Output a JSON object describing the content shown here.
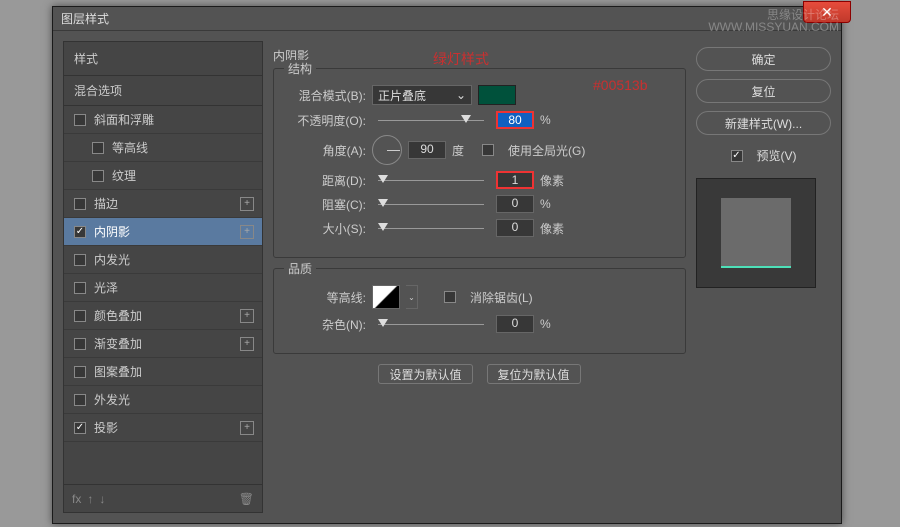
{
  "window": {
    "title": "图层样式"
  },
  "watermark": {
    "line1": "思缘设计论坛",
    "line2": "WWW.MISSYUAN.COM"
  },
  "annotations": {
    "greenStyle": "绿灯样式",
    "colorHex": "#00513b"
  },
  "leftPanel": {
    "stylesHeader": "样式",
    "blendHeader": "混合选项",
    "items": [
      {
        "label": "斜面和浮雕",
        "checked": false,
        "hasAdd": false,
        "sub": false
      },
      {
        "label": "等高线",
        "checked": false,
        "hasAdd": false,
        "sub": true
      },
      {
        "label": "纹理",
        "checked": false,
        "hasAdd": false,
        "sub": true
      },
      {
        "label": "描边",
        "checked": false,
        "hasAdd": true,
        "sub": false
      },
      {
        "label": "内阴影",
        "checked": true,
        "hasAdd": true,
        "sub": false,
        "selected": true
      },
      {
        "label": "内发光",
        "checked": false,
        "hasAdd": false,
        "sub": false
      },
      {
        "label": "光泽",
        "checked": false,
        "hasAdd": false,
        "sub": false
      },
      {
        "label": "颜色叠加",
        "checked": false,
        "hasAdd": true,
        "sub": false
      },
      {
        "label": "渐变叠加",
        "checked": false,
        "hasAdd": true,
        "sub": false
      },
      {
        "label": "图案叠加",
        "checked": false,
        "hasAdd": false,
        "sub": false
      },
      {
        "label": "外发光",
        "checked": false,
        "hasAdd": false,
        "sub": false
      },
      {
        "label": "投影",
        "checked": true,
        "hasAdd": true,
        "sub": false
      }
    ],
    "footer": {
      "fx": "fx"
    }
  },
  "center": {
    "title": "内阴影",
    "structure": {
      "groupLabel": "结构",
      "blendMode": {
        "label": "混合模式(B):",
        "value": "正片叠底"
      },
      "opacity": {
        "label": "不透明度(O):",
        "value": "80",
        "unit": "%"
      },
      "angle": {
        "label": "角度(A):",
        "value": "90",
        "unit": "度",
        "globalLight": "使用全局光(G)"
      },
      "distance": {
        "label": "距离(D):",
        "value": "1",
        "unit": "像素"
      },
      "choke": {
        "label": "阻塞(C):",
        "value": "0",
        "unit": "%"
      },
      "size": {
        "label": "大小(S):",
        "value": "0",
        "unit": "像素"
      }
    },
    "quality": {
      "groupLabel": "品质",
      "contour": {
        "label": "等高线:",
        "antialias": "消除锯齿(L)"
      },
      "noise": {
        "label": "杂色(N):",
        "value": "0",
        "unit": "%"
      }
    },
    "buttons": {
      "setDefault": "设置为默认值",
      "resetDefault": "复位为默认值"
    }
  },
  "right": {
    "ok": "确定",
    "reset": "复位",
    "newStyle": "新建样式(W)...",
    "preview": "预览(V)"
  }
}
